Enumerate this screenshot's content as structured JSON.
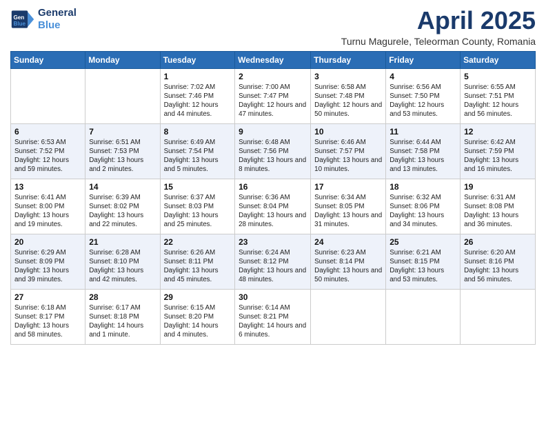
{
  "header": {
    "logo_line1": "General",
    "logo_line2": "Blue",
    "month": "April 2025",
    "location": "Turnu Magurele, Teleorman County, Romania"
  },
  "days_of_week": [
    "Sunday",
    "Monday",
    "Tuesday",
    "Wednesday",
    "Thursday",
    "Friday",
    "Saturday"
  ],
  "weeks": [
    [
      {
        "day": "",
        "info": ""
      },
      {
        "day": "",
        "info": ""
      },
      {
        "day": "1",
        "info": "Sunrise: 7:02 AM\nSunset: 7:46 PM\nDaylight: 12 hours and 44 minutes."
      },
      {
        "day": "2",
        "info": "Sunrise: 7:00 AM\nSunset: 7:47 PM\nDaylight: 12 hours and 47 minutes."
      },
      {
        "day": "3",
        "info": "Sunrise: 6:58 AM\nSunset: 7:48 PM\nDaylight: 12 hours and 50 minutes."
      },
      {
        "day": "4",
        "info": "Sunrise: 6:56 AM\nSunset: 7:50 PM\nDaylight: 12 hours and 53 minutes."
      },
      {
        "day": "5",
        "info": "Sunrise: 6:55 AM\nSunset: 7:51 PM\nDaylight: 12 hours and 56 minutes."
      }
    ],
    [
      {
        "day": "6",
        "info": "Sunrise: 6:53 AM\nSunset: 7:52 PM\nDaylight: 12 hours and 59 minutes."
      },
      {
        "day": "7",
        "info": "Sunrise: 6:51 AM\nSunset: 7:53 PM\nDaylight: 13 hours and 2 minutes."
      },
      {
        "day": "8",
        "info": "Sunrise: 6:49 AM\nSunset: 7:54 PM\nDaylight: 13 hours and 5 minutes."
      },
      {
        "day": "9",
        "info": "Sunrise: 6:48 AM\nSunset: 7:56 PM\nDaylight: 13 hours and 8 minutes."
      },
      {
        "day": "10",
        "info": "Sunrise: 6:46 AM\nSunset: 7:57 PM\nDaylight: 13 hours and 10 minutes."
      },
      {
        "day": "11",
        "info": "Sunrise: 6:44 AM\nSunset: 7:58 PM\nDaylight: 13 hours and 13 minutes."
      },
      {
        "day": "12",
        "info": "Sunrise: 6:42 AM\nSunset: 7:59 PM\nDaylight: 13 hours and 16 minutes."
      }
    ],
    [
      {
        "day": "13",
        "info": "Sunrise: 6:41 AM\nSunset: 8:00 PM\nDaylight: 13 hours and 19 minutes."
      },
      {
        "day": "14",
        "info": "Sunrise: 6:39 AM\nSunset: 8:02 PM\nDaylight: 13 hours and 22 minutes."
      },
      {
        "day": "15",
        "info": "Sunrise: 6:37 AM\nSunset: 8:03 PM\nDaylight: 13 hours and 25 minutes."
      },
      {
        "day": "16",
        "info": "Sunrise: 6:36 AM\nSunset: 8:04 PM\nDaylight: 13 hours and 28 minutes."
      },
      {
        "day": "17",
        "info": "Sunrise: 6:34 AM\nSunset: 8:05 PM\nDaylight: 13 hours and 31 minutes."
      },
      {
        "day": "18",
        "info": "Sunrise: 6:32 AM\nSunset: 8:06 PM\nDaylight: 13 hours and 34 minutes."
      },
      {
        "day": "19",
        "info": "Sunrise: 6:31 AM\nSunset: 8:08 PM\nDaylight: 13 hours and 36 minutes."
      }
    ],
    [
      {
        "day": "20",
        "info": "Sunrise: 6:29 AM\nSunset: 8:09 PM\nDaylight: 13 hours and 39 minutes."
      },
      {
        "day": "21",
        "info": "Sunrise: 6:28 AM\nSunset: 8:10 PM\nDaylight: 13 hours and 42 minutes."
      },
      {
        "day": "22",
        "info": "Sunrise: 6:26 AM\nSunset: 8:11 PM\nDaylight: 13 hours and 45 minutes."
      },
      {
        "day": "23",
        "info": "Sunrise: 6:24 AM\nSunset: 8:12 PM\nDaylight: 13 hours and 48 minutes."
      },
      {
        "day": "24",
        "info": "Sunrise: 6:23 AM\nSunset: 8:14 PM\nDaylight: 13 hours and 50 minutes."
      },
      {
        "day": "25",
        "info": "Sunrise: 6:21 AM\nSunset: 8:15 PM\nDaylight: 13 hours and 53 minutes."
      },
      {
        "day": "26",
        "info": "Sunrise: 6:20 AM\nSunset: 8:16 PM\nDaylight: 13 hours and 56 minutes."
      }
    ],
    [
      {
        "day": "27",
        "info": "Sunrise: 6:18 AM\nSunset: 8:17 PM\nDaylight: 13 hours and 58 minutes."
      },
      {
        "day": "28",
        "info": "Sunrise: 6:17 AM\nSunset: 8:18 PM\nDaylight: 14 hours and 1 minute."
      },
      {
        "day": "29",
        "info": "Sunrise: 6:15 AM\nSunset: 8:20 PM\nDaylight: 14 hours and 4 minutes."
      },
      {
        "day": "30",
        "info": "Sunrise: 6:14 AM\nSunset: 8:21 PM\nDaylight: 14 hours and 6 minutes."
      },
      {
        "day": "",
        "info": ""
      },
      {
        "day": "",
        "info": ""
      },
      {
        "day": "",
        "info": ""
      }
    ]
  ]
}
